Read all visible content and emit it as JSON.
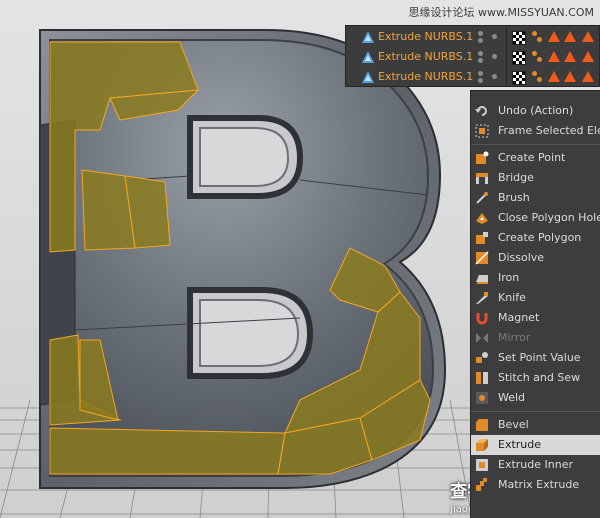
{
  "watermarks": {
    "top": "思缘设计论坛 www.MISSYUAN.COM",
    "bottom_main": "查字典 教程网",
    "bottom_sub": "jiaocheng.chazidian.com"
  },
  "object_manager": {
    "rows": [
      {
        "name": "Extrude NURBS.1"
      },
      {
        "name": "Extrude NURBS.1"
      },
      {
        "name": "Extrude NURBS.1"
      }
    ]
  },
  "context_menu": {
    "items": [
      {
        "label": "Undo (Action)",
        "icon": "undo-icon"
      },
      {
        "label": "Frame Selected Elem",
        "icon": "frame-selected-icon"
      },
      {
        "label": "Create Point",
        "icon": "create-point-icon"
      },
      {
        "label": "Bridge",
        "icon": "bridge-icon"
      },
      {
        "label": "Brush",
        "icon": "brush-icon"
      },
      {
        "label": "Close Polygon Hole",
        "icon": "close-polygon-hole-icon"
      },
      {
        "label": "Create Polygon",
        "icon": "create-polygon-icon"
      },
      {
        "label": "Dissolve",
        "icon": "dissolve-icon"
      },
      {
        "label": "Iron",
        "icon": "iron-icon"
      },
      {
        "label": "Knife",
        "icon": "knife-icon"
      },
      {
        "label": "Magnet",
        "icon": "magnet-icon"
      },
      {
        "label": "Mirror",
        "icon": "mirror-icon",
        "disabled": true
      },
      {
        "label": "Set Point Value",
        "icon": "set-point-value-icon"
      },
      {
        "label": "Stitch and Sew",
        "icon": "stitch-and-sew-icon"
      },
      {
        "label": "Weld",
        "icon": "weld-icon"
      },
      {
        "label": "Bevel",
        "icon": "bevel-icon"
      },
      {
        "label": "Extrude",
        "icon": "extrude-icon",
        "active": true
      },
      {
        "label": "Extrude Inner",
        "icon": "extrude-inner-icon"
      },
      {
        "label": "Matrix Extrude",
        "icon": "matrix-extrude-icon"
      }
    ]
  },
  "colors": {
    "selection_fill": "#8a7a1e",
    "selection_edge": "#f5a623",
    "object_name": "#f3a33a",
    "menu_bg": "#3d3d3d",
    "menu_active_bg": "#d8d8d8"
  }
}
